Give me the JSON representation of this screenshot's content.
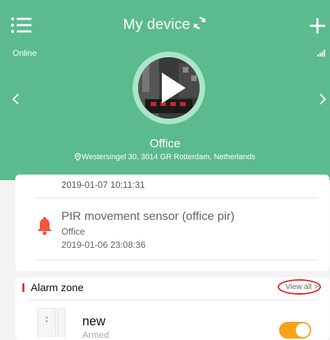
{
  "header": {
    "title": "My device",
    "status": "Online",
    "device_name": "Office",
    "address": "Westersingel 30, 3014 GR Rotterdam, Netherlands"
  },
  "events": {
    "prev_timestamp": "2019-01-07 10:11:31",
    "items": [
      {
        "title": "PIR movement sensor (office pir)",
        "location": "Office",
        "timestamp": "2019-01-06 23:08:36"
      }
    ]
  },
  "alarm_zone": {
    "title": "Alarm zone",
    "view_all": "View all >",
    "sensors": [
      {
        "name": "new",
        "status": "Armed",
        "enabled": true
      }
    ]
  },
  "colors": {
    "header_bg": "#5cba8f",
    "alert_icon": "#f0573c",
    "accent_red": "#e03030",
    "toggle_on": "#f7a21b",
    "annotation_oval": "#e01e1e"
  },
  "icons": [
    "menu-icon",
    "refresh-icon",
    "add-icon",
    "signal-icon",
    "chevron-left-icon",
    "chevron-right-icon",
    "play-icon",
    "location-pin-icon",
    "bell-icon",
    "door-sensor-icon"
  ]
}
